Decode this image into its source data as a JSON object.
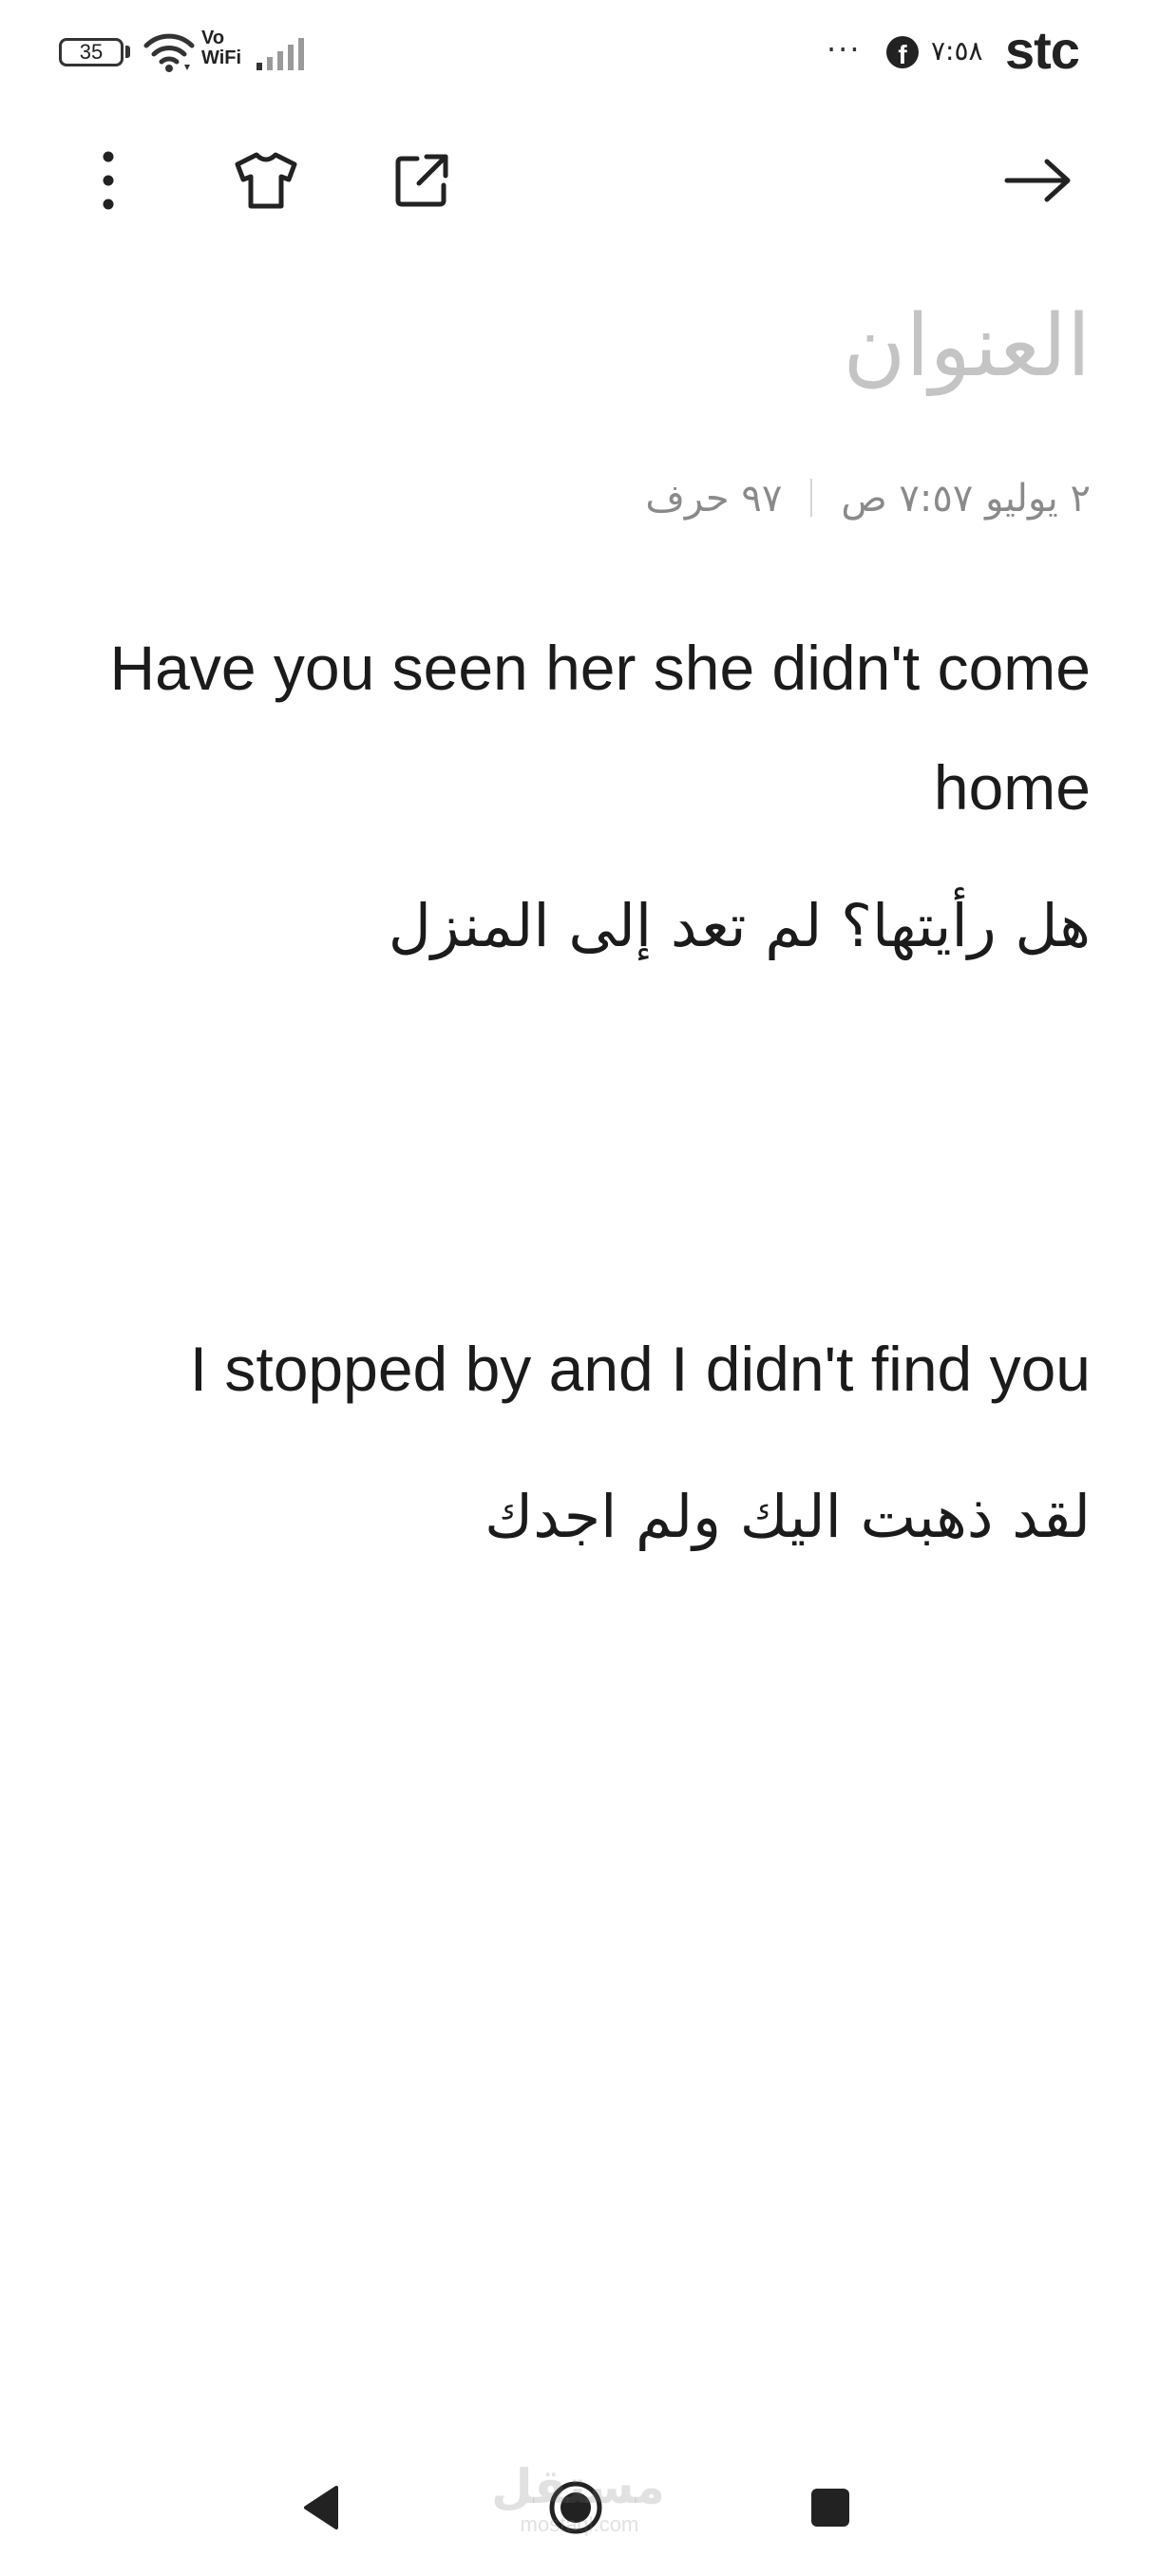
{
  "status_bar": {
    "battery": "35",
    "network_label_top": "Vo",
    "network_label_bottom": "WiFi",
    "overflow": "···",
    "time": "٧:٥٨",
    "carrier": "stc",
    "icons": [
      "battery-icon",
      "wifi-icon",
      "signal-icon",
      "facebook-icon"
    ]
  },
  "toolbar": {
    "icons": [
      "more-vertical-icon",
      "theme-shirt-icon",
      "share-external-icon",
      "arrow-forward-icon"
    ]
  },
  "note": {
    "title_placeholder": "العنوان",
    "date": "٢ يوليو ٧:٥٧ ص",
    "char_count": "٩٧ حرف",
    "lines": [
      "Have you seen her she didn't come home",
      "هل رأيتها؟ لم تعد إلى المنزل",
      "",
      "I stopped by and I didn't find you",
      "لقد ذهبت اليك ولم اجدك"
    ]
  },
  "nav_bar": {
    "icons": [
      "back-triangle-icon",
      "home-circle-icon",
      "recents-square-icon"
    ]
  },
  "watermark": {
    "arabic": "مستقل",
    "latin": "mostaql.com"
  }
}
